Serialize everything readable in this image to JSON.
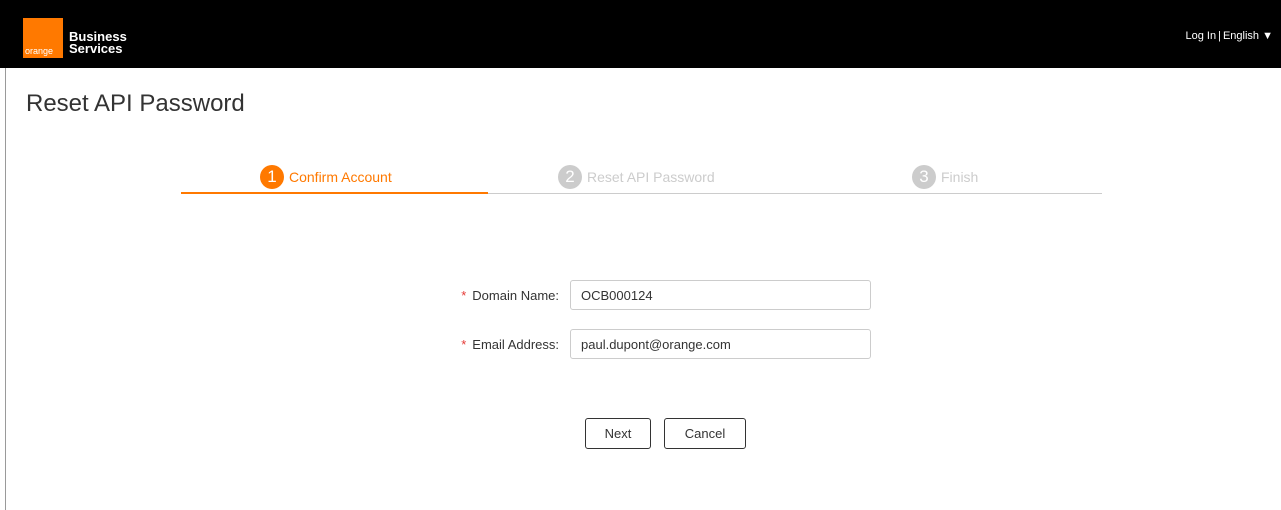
{
  "header": {
    "logo_text": "orange",
    "brand_line1": "Business",
    "brand_line2": "Services",
    "login_label": "Log In",
    "separator": "|",
    "language_label": "English",
    "language_caret": "▼",
    "accent_color": "#ff7900"
  },
  "page": {
    "title": "Reset API Password"
  },
  "steps": [
    {
      "number": "1",
      "label": "Confirm Account",
      "state": "active"
    },
    {
      "number": "2",
      "label": "Reset API Password",
      "state": "inactive"
    },
    {
      "number": "3",
      "label": "Finish",
      "state": "inactive"
    }
  ],
  "form": {
    "required_mark": "*",
    "domain": {
      "label": "Domain Name:",
      "value": "OCB000124"
    },
    "email": {
      "label": "Email Address:",
      "value": "paul.dupont@orange.com"
    }
  },
  "buttons": {
    "next_label": "Next",
    "cancel_label": "Cancel"
  }
}
